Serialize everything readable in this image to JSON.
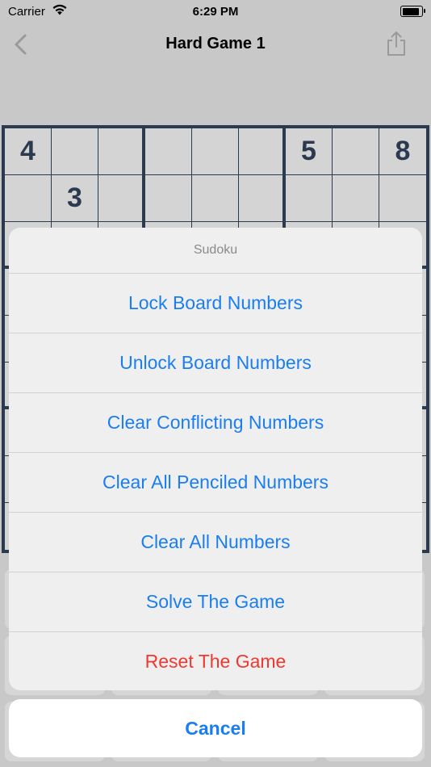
{
  "status_bar": {
    "carrier": "Carrier",
    "time": "6:29 PM",
    "battery_level": 0.9
  },
  "nav": {
    "title": "Hard Game 1",
    "back_icon": "chevron-left-icon",
    "share_icon": "share-icon"
  },
  "board": {
    "rows": [
      [
        "4",
        "",
        "",
        "",
        "",
        "",
        "5",
        "",
        "8"
      ],
      [
        "",
        "3",
        "",
        "",
        "",
        "",
        "",
        "",
        ""
      ],
      [
        "",
        "",
        "",
        "",
        "",
        "",
        "",
        "",
        ""
      ],
      [
        "",
        "",
        "",
        "",
        "",
        "",
        "",
        "",
        ""
      ],
      [
        "",
        "",
        "",
        "",
        "",
        "",
        "",
        "",
        ""
      ],
      [
        "",
        "",
        "",
        "",
        "",
        "",
        "",
        "",
        ""
      ],
      [
        "",
        "",
        "",
        "",
        "",
        "",
        "",
        "",
        ""
      ],
      [
        "",
        "",
        "",
        "",
        "",
        "",
        "",
        "",
        ""
      ],
      [
        "",
        "",
        "",
        "",
        "",
        "",
        "",
        "",
        ""
      ]
    ]
  },
  "action_sheet": {
    "title": "Sudoku",
    "actions": [
      {
        "label": "Lock Board Numbers",
        "style": "default"
      },
      {
        "label": "Unlock Board Numbers",
        "style": "default"
      },
      {
        "label": "Clear Conflicting Numbers",
        "style": "default"
      },
      {
        "label": "Clear All Penciled Numbers",
        "style": "default"
      },
      {
        "label": "Clear All Numbers",
        "style": "default"
      },
      {
        "label": "Solve The Game",
        "style": "default"
      },
      {
        "label": "Reset The Game",
        "style": "destructive"
      }
    ],
    "cancel_label": "Cancel"
  },
  "colors": {
    "accent": "#1a7ef0",
    "destructive": "#f1382f",
    "board_line": "#2b3a4e",
    "dim_background": "#c8c8c8"
  }
}
